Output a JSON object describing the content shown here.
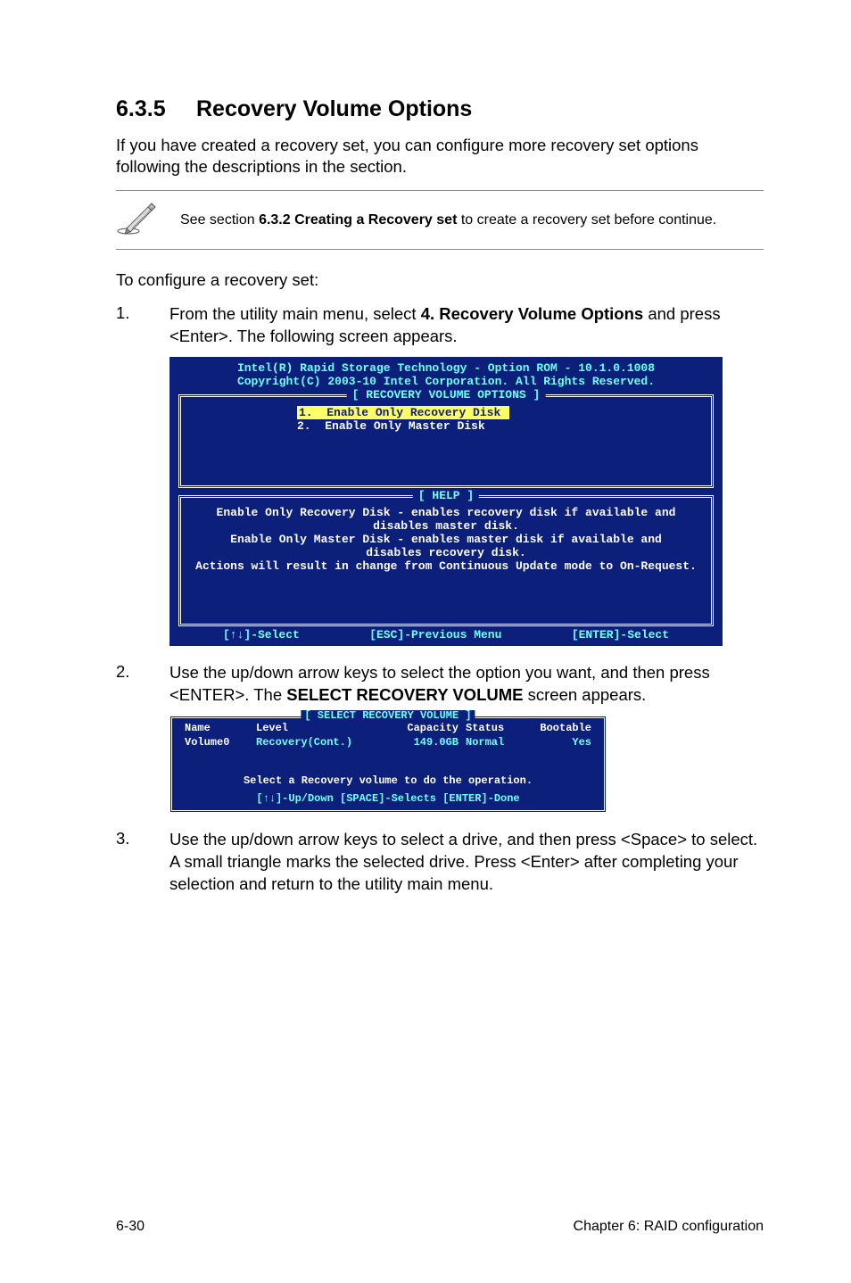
{
  "heading": {
    "number": "6.3.5",
    "title": "Recovery Volume Options"
  },
  "intro": "If you have created a recovery set, you can configure more recovery set options following the descriptions in the section.",
  "note": {
    "prefix": "See section ",
    "bold": "6.3.2 Creating a Recovery set",
    "suffix": " to create a recovery set before continue."
  },
  "configure_line": "To configure a recovery set:",
  "steps": {
    "s1": {
      "num": "1.",
      "pre": "From the utility main menu, select ",
      "bold": "4. Recovery Volume Options",
      "post": " and press <Enter>. The following screen appears."
    },
    "s2": {
      "num": "2.",
      "pre": "Use the up/down arrow keys to select the option you want, and then press <ENTER>. The ",
      "bold": "SELECT RECOVERY VOLUME",
      "post": " screen appears."
    },
    "s3": {
      "num": "3.",
      "text": "Use the up/down arrow keys to select a drive, and then press <Space> to select. A small triangle marks the selected drive. Press <Enter> after completing your selection and return to the utility main menu."
    }
  },
  "bios1": {
    "title1": "Intel(R) Rapid Storage Technology - Option ROM - 10.1.0.1008",
    "title2": "Copyright(C) 2003-10 Intel Corporation.  All Rights Reserved.",
    "panel_title": "[ RECOVERY VOLUME OPTIONS ]",
    "menu1_num": "1.",
    "menu1": "Enable Only Recovery Disk",
    "menu2_num": "2.",
    "menu2": "Enable Only Master Disk",
    "help_title": "[ HELP ]",
    "help1": "Enable Only Recovery Disk - enables recovery disk if available and",
    "help2": "disables master disk.",
    "help3": "Enable Only Master Disk - enables master disk if available and",
    "help4": "disables recovery disk.",
    "help5": "Actions will result in change from Continuous Update mode to On-Request.",
    "footer_left": "[↑↓]-Select",
    "footer_mid": "[ESC]-Previous Menu",
    "footer_right": "[ENTER]-Select"
  },
  "bios2": {
    "title": "[ SELECT RECOVERY VOLUME ]",
    "headers": {
      "name": "Name",
      "level": "Level",
      "capacity": "Capacity",
      "status": "Status",
      "bootable": "Bootable"
    },
    "row": {
      "name": "Volume0",
      "level": "Recovery(Cont.)",
      "capacity": "149.0GB",
      "status": "Normal",
      "bootable": "Yes"
    },
    "instruction": "Select a Recovery volume to do the operation.",
    "footer": "[↑↓]-Up/Down [SPACE]-Selects [ENTER]-Done"
  },
  "footer": {
    "left": "6-30",
    "right": "Chapter 6: RAID configuration"
  }
}
